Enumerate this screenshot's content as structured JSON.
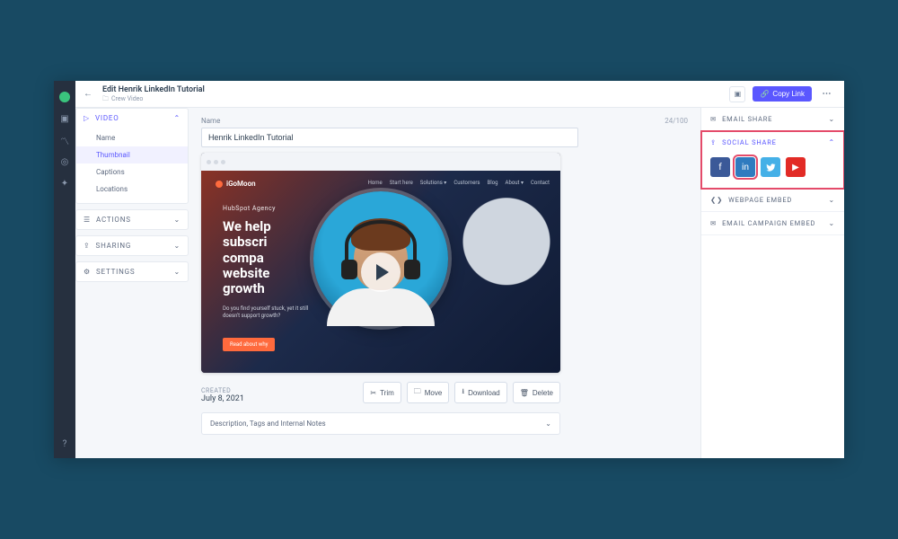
{
  "header": {
    "title": "Edit Henrik LinkedIn Tutorial",
    "crew_label": "Crew Video",
    "copy_link_label": "Copy Link"
  },
  "sidebar": {
    "video_label": "VIDEO",
    "actions_label": "ACTIONS",
    "sharing_label": "SHARING",
    "settings_label": "SETTINGS",
    "items": [
      {
        "label": "Name"
      },
      {
        "label": "Thumbnail"
      },
      {
        "label": "Captions"
      },
      {
        "label": "Locations"
      }
    ]
  },
  "main": {
    "name_field_label": "Name",
    "name_value": "Henrik LinkedIn Tutorial",
    "name_count": "24/100",
    "hero_agency": "HubSpot Agency",
    "hero_line1": "We help",
    "hero_line2": "subscri",
    "hero_line3": "compa",
    "hero_line4": "website",
    "hero_line5": "growth",
    "hero_sub": "Do you find yourself stuck, yet it still doesn't support growth?",
    "hero_cta": "Read about why",
    "brand": "iGoMoon",
    "nav": [
      "Home",
      "Start here",
      "Solutions ▾",
      "Customers",
      "Blog",
      "About ▾",
      "Contact"
    ],
    "created_label": "CREATED",
    "created_date": "July 8, 2021",
    "buttons": {
      "trim": "Trim",
      "move": "Move",
      "download": "Download",
      "delete": "Delete"
    },
    "description_label": "Description, Tags and Internal Notes"
  },
  "share": {
    "email_label": "EMAIL SHARE",
    "social_label": "SOCIAL SHARE",
    "webpage_label": "WEBPAGE EMBED",
    "campaign_label": "EMAIL CAMPAIGN EMBED"
  }
}
